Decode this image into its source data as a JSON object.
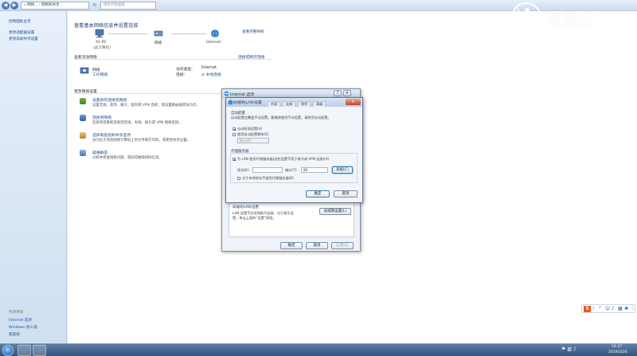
{
  "toolbar": {
    "back_icon": "back-arrow-icon",
    "forward_icon": "forward-arrow-icon",
    "address": "« 网络...  › 网络和共享...",
    "search_placeholder": "搜索控制面板"
  },
  "sidebar": {
    "home": "控制面板主页",
    "links": [
      "更改适配器设置",
      "更改高级共享设置"
    ],
    "see_also_title": "另请参阅",
    "see_also": [
      "Internet 选项",
      "Windows 防火墙",
      "家庭组"
    ]
  },
  "main": {
    "title": "查看基本网络信息并设置连接",
    "map_link": "查看完整映射",
    "nodes": [
      {
        "label": "X1-PC",
        "sublabel": "(此计算机)"
      },
      {
        "label": "网络",
        "sublabel": ""
      },
      {
        "label": "Internet",
        "sublabel": ""
      }
    ],
    "active_networks": "查看活动网络",
    "connect_disconnect": "连接或断开连接",
    "network_name": "网络",
    "network_type": "工作网络",
    "access_type_label": "访问类型:",
    "access_type_value": "Internet",
    "connections_label": "连接:",
    "connections_value": "本地连接",
    "change_settings": "更改网络设置",
    "tasks": [
      {
        "title": "设置新的连接或网络",
        "desc": "设置无线、宽带、拨号、临时或 VPN 连接；或设置路由器或访问点。"
      },
      {
        "title": "连接到网络",
        "desc": "连接到或重新连接到无线、有线、拨号或 VPN 网络连接。"
      },
      {
        "title": "选择家庭组和共享选项",
        "desc": "访问位于其他网络计算机上的文件和打印机，或更改共享设置。"
      },
      {
        "title": "疑难解答",
        "desc": "诊断并修复网络问题，或获得故障排除信息。"
      }
    ]
  },
  "inet_dialog": {
    "title": "Internet 选项",
    "help_btn": "?",
    "close_btn": "✕",
    "lan_group_title": "局域网(LAN)设置",
    "lan_group_text_1": "LAN 设置不应用到拨号连接。对于拨号设",
    "lan_group_text_2": "置，单击上面的“设置”按钮。",
    "lan_settings_btn": "局域网设置(L)",
    "ok": "确定",
    "cancel": "取消",
    "apply": "应用(A)"
  },
  "lan_dialog": {
    "title": "局域网(LAN)设置",
    "tabs": [
      "内容",
      "连接",
      "程序",
      "高级"
    ],
    "auto_config_title": "自动配置",
    "auto_config_desc": "自动配置会覆盖手动设置。要确保使用手动设置，请禁用自动配置。",
    "auto_detect": "自动检测设置(A)",
    "auto_script": "使用自动配置脚本(S)",
    "address_label": "地址(R)",
    "proxy_title": "代理服务器",
    "proxy_use": "为 LAN 使用代理服务器(这些设置不用于拨号或 VPN 连接)(X)",
    "proxy_address_label": "地址(E):",
    "proxy_port_label": "端口(T):",
    "proxy_port_value": "80",
    "advanced_btn": "高级(C)",
    "bypass_local": "对于本地地址不使用代理服务器(B)",
    "ok": "确定",
    "cancel": "取消",
    "close_btn": "✕"
  },
  "watermark": {
    "text": "云骑士"
  },
  "taskbar": {
    "clock_time": "14:37",
    "clock_date": "2019/3/26"
  },
  "colors": {
    "link": "#1e4e91",
    "sidebar_bg": "#dbe7f5",
    "taskbar": "#3b5c85"
  }
}
